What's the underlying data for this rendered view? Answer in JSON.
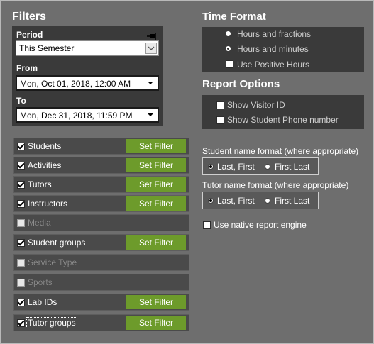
{
  "filters": {
    "title": "Filters",
    "period": {
      "label": "Period",
      "value": "This Semester"
    },
    "from": {
      "label": "From",
      "value": "Mon,  Oct 01, 2018, 12:00 AM"
    },
    "to": {
      "label": "To",
      "value": "Mon, Dec 31, 2018, 11:59 PM"
    },
    "set_filter_label": "Set Filter",
    "items": [
      {
        "label": "Students",
        "checked": true,
        "enabled": true
      },
      {
        "label": "Activities",
        "checked": true,
        "enabled": true
      },
      {
        "label": "Tutors",
        "checked": true,
        "enabled": true
      },
      {
        "label": "Instructors",
        "checked": true,
        "enabled": true
      },
      {
        "label": "Media",
        "checked": false,
        "enabled": false
      },
      {
        "label": "Student groups",
        "checked": true,
        "enabled": true
      },
      {
        "label": "Service Type",
        "checked": false,
        "enabled": false
      },
      {
        "label": "Sports",
        "checked": false,
        "enabled": false
      },
      {
        "label": "Lab IDs",
        "checked": true,
        "enabled": true
      },
      {
        "label": "Tutor groups",
        "checked": true,
        "enabled": true
      }
    ]
  },
  "time_format": {
    "title": "Time Format",
    "options": [
      {
        "label": "Hours and fractions",
        "selected": false
      },
      {
        "label": "Hours and minutes",
        "selected": true
      }
    ],
    "use_positive_hours": "Use Positive Hours"
  },
  "report_options": {
    "title": "Report Options",
    "show_visitor_id": "Show Visitor ID",
    "show_student_phone": "Show Student Phone number"
  },
  "student_name_format": {
    "label": "Student name format (where appropriate)",
    "options": [
      "Last, First",
      "First Last"
    ]
  },
  "tutor_name_format": {
    "label": "Tutor name format (where appropriate)",
    "options": [
      "Last, First",
      "First Last"
    ]
  },
  "use_native_engine": "Use native report engine"
}
